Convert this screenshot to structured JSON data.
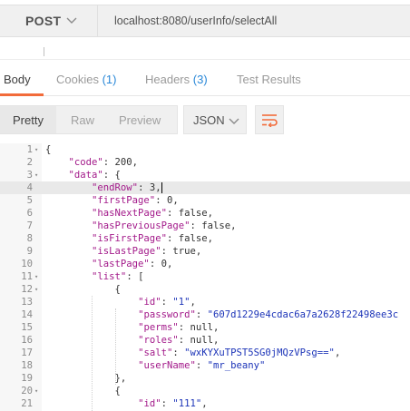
{
  "request": {
    "method": "POST",
    "url": "localhost:8080/userInfo/selectAll"
  },
  "tabs": [
    {
      "label": "Body",
      "count": ""
    },
    {
      "label": "Cookies",
      "count": "(1)"
    },
    {
      "label": "Headers",
      "count": "(3)"
    },
    {
      "label": "Test Results",
      "count": ""
    }
  ],
  "toolbar": {
    "views": [
      "Pretty",
      "Raw",
      "Preview"
    ],
    "format": "JSON"
  },
  "code_lines": [
    {
      "n": "1",
      "fold": true,
      "t": "{"
    },
    {
      "n": "2",
      "fold": false,
      "t": "    \"code\": 200,"
    },
    {
      "n": "3",
      "fold": true,
      "t": "    \"data\": {"
    },
    {
      "n": "4",
      "fold": false,
      "t": "        \"endRow\": 3,"
    },
    {
      "n": "5",
      "fold": false,
      "t": "        \"firstPage\": 0,"
    },
    {
      "n": "6",
      "fold": false,
      "t": "        \"hasNextPage\": false,"
    },
    {
      "n": "7",
      "fold": false,
      "t": "        \"hasPreviousPage\": false,"
    },
    {
      "n": "8",
      "fold": false,
      "t": "        \"isFirstPage\": false,"
    },
    {
      "n": "9",
      "fold": false,
      "t": "        \"isLastPage\": true,"
    },
    {
      "n": "10",
      "fold": false,
      "t": "        \"lastPage\": 0,"
    },
    {
      "n": "11",
      "fold": true,
      "t": "        \"list\": ["
    },
    {
      "n": "12",
      "fold": true,
      "t": "            {"
    },
    {
      "n": "13",
      "fold": false,
      "t": "                \"id\": \"1\","
    },
    {
      "n": "14",
      "fold": false,
      "t": "                \"password\": \"607d1229e4cdac6a7a2628f22498ee3c"
    },
    {
      "n": "15",
      "fold": false,
      "t": "                \"perms\": null,"
    },
    {
      "n": "16",
      "fold": false,
      "t": "                \"roles\": null,"
    },
    {
      "n": "17",
      "fold": false,
      "t": "                \"salt\": \"wxKYXuTPST5SG0jMQzVPsg==\","
    },
    {
      "n": "18",
      "fold": false,
      "t": "                \"userName\": \"mr_beany\""
    },
    {
      "n": "19",
      "fold": false,
      "t": "            },"
    },
    {
      "n": "20",
      "fold": true,
      "t": "            {"
    },
    {
      "n": "21",
      "fold": false,
      "t": "                \"id\": \"111\","
    }
  ],
  "current_line": "4",
  "colors": {
    "accent": "#f26b3a",
    "count": "#2a88d8",
    "key": "#a31a8a",
    "string": "#1c34b8"
  }
}
